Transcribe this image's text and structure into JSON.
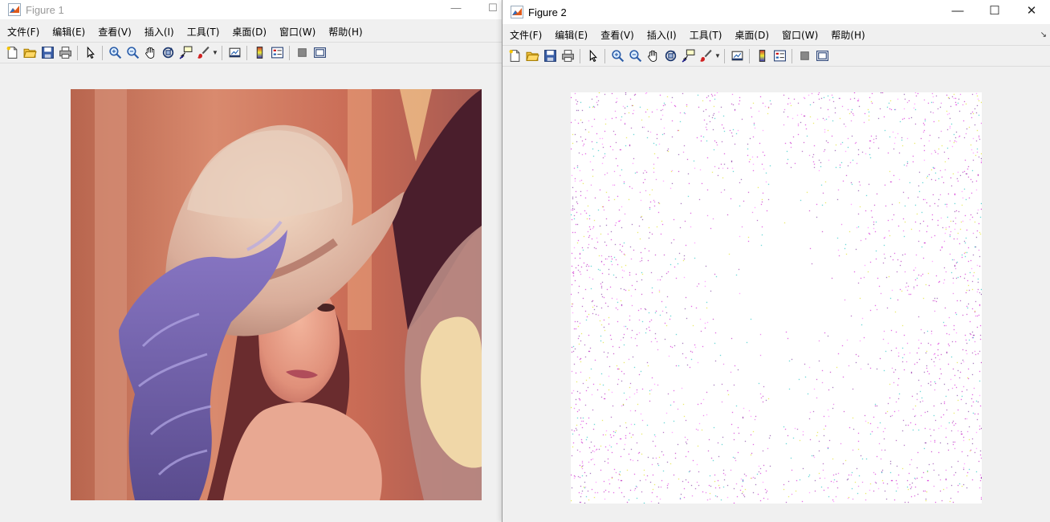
{
  "figure1": {
    "title": "Figure 1",
    "menu": [
      "文件(F)",
      "编辑(E)",
      "查看(V)",
      "插入(I)",
      "工具(T)",
      "桌面(D)",
      "窗口(W)",
      "帮助(H)"
    ]
  },
  "figure2": {
    "title": "Figure 2",
    "menu": [
      "文件(F)",
      "编辑(E)",
      "查看(V)",
      "插入(I)",
      "工具(T)",
      "桌面(D)",
      "窗口(W)",
      "帮助(H)"
    ],
    "controls": {
      "minimize": "—",
      "maximize": "☐",
      "close": "✕"
    },
    "dock_arrow": "↘"
  },
  "toolbar_icons": [
    "new-figure-icon",
    "open-file-icon",
    "save-icon",
    "print-icon",
    "edit-plot-arrow-icon",
    "zoom-in-icon",
    "zoom-out-icon",
    "pan-hand-icon",
    "rotate-3d-icon",
    "data-cursor-icon",
    "brush-icon",
    "brush-dropdown-icon",
    "link-plot-icon",
    "insert-colorbar-icon",
    "insert-legend-icon",
    "hide-plot-tools-icon",
    "show-plot-tools-icon"
  ],
  "colors": {
    "title_inactive": "#9a9a9a",
    "title_active": "#000000",
    "window_bg": "#f0f0f0",
    "noise_magenta": "#cc00cc",
    "noise_purple": "#8a1aa0"
  }
}
